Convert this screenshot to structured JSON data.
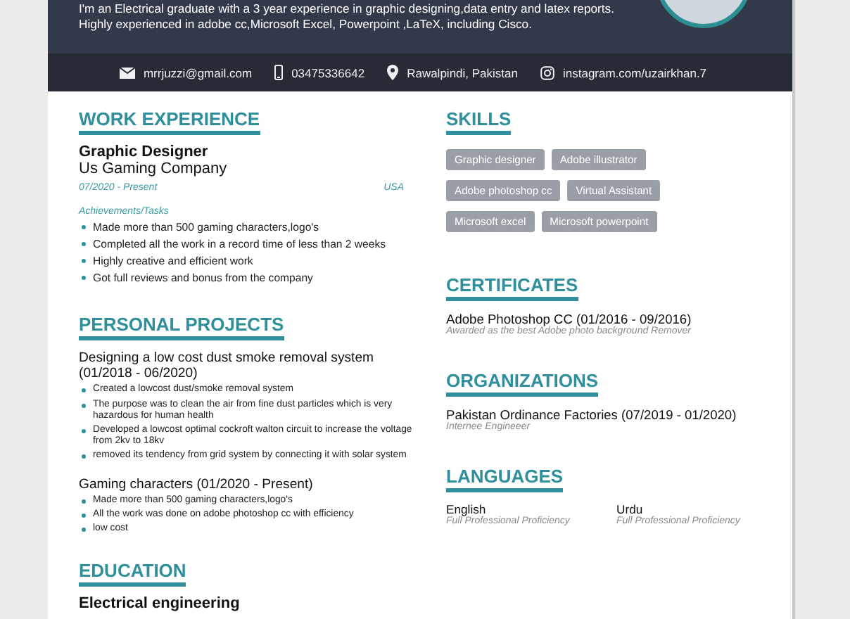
{
  "header": {
    "summary": [
      "I'm an Electrical graduate with a 3 year experience in graphic designing,data entry and latex reports.",
      "Highly experienced in adobe cc,Microsoft Excel, Powerpoint ,LaTeX, including Cisco."
    ],
    "contacts": [
      {
        "kind": "email",
        "text": "mrrjuzzi@gmail.com"
      },
      {
        "kind": "phone",
        "text": "03475336642"
      },
      {
        "kind": "location",
        "text": "Rawalpindi, Pakistan"
      },
      {
        "kind": "instagram",
        "text": "instagram.com/uzairkhan.7"
      }
    ]
  },
  "work_experience": {
    "heading": "WORK EXPERIENCE",
    "jobs": [
      {
        "title": "Graphic Designer",
        "company": "Us Gaming Company",
        "dates": "07/2020 - Present",
        "location": "USA",
        "tasks_label": "Achievements/Tasks",
        "tasks": [
          "Made more than 500 gaming characters,logo's",
          "Completed all the work in a record time of less than 2 weeks",
          "Highly creative and efficient work",
          "Got full reviews and bonus from the company"
        ]
      }
    ]
  },
  "personal_projects": {
    "heading": "PERSONAL PROJECTS",
    "projects": [
      {
        "title": "Designing a low cost dust smoke removal system (01/2018 - 06/2020)",
        "points": [
          "Created a lowcost dust/smoke removal system",
          "The purpose was to clean the air from fine dust particles which is very hazardous for human health",
          "Developed a lowcost optimal cockroft walton circuit to increase the voltage from 2kv to 18kv",
          "removed its tendency from grid system by connecting it with solar system"
        ]
      },
      {
        "title": "Gaming characters (01/2020 - Present)",
        "points": [
          "Made more than 500 gaming characters,logo's",
          "All the work was done on adobe photoshop cc with efficiency",
          "low cost"
        ]
      }
    ]
  },
  "education": {
    "heading": "EDUCATION",
    "items": [
      {
        "degree": "Electrical engineering"
      }
    ]
  },
  "skills": {
    "heading": "SKILLS",
    "tags": [
      "Graphic designer",
      "Adobe illustrator",
      "Adobe photoshop cc",
      "Virtual Assistant",
      "Microsoft excel",
      "Microsoft powerpoint"
    ]
  },
  "certificates": {
    "heading": "CERTIFICATES",
    "items": [
      {
        "title": "Adobe Photoshop CC (01/2016 - 09/2016)",
        "note": "Awarded as the best Adobe photo background Remover"
      }
    ]
  },
  "organizations": {
    "heading": "ORGANIZATIONS",
    "items": [
      {
        "title": "Pakistan Ordinance Factories (07/2019 - 01/2020)",
        "note": "Internee Engineeer"
      }
    ]
  },
  "languages": {
    "heading": "LANGUAGES",
    "items": [
      {
        "name": "English",
        "level_text": "Full Professional Proficiency"
      },
      {
        "name": "Urdu",
        "level_text": "Full Professional Proficiency"
      }
    ]
  }
}
